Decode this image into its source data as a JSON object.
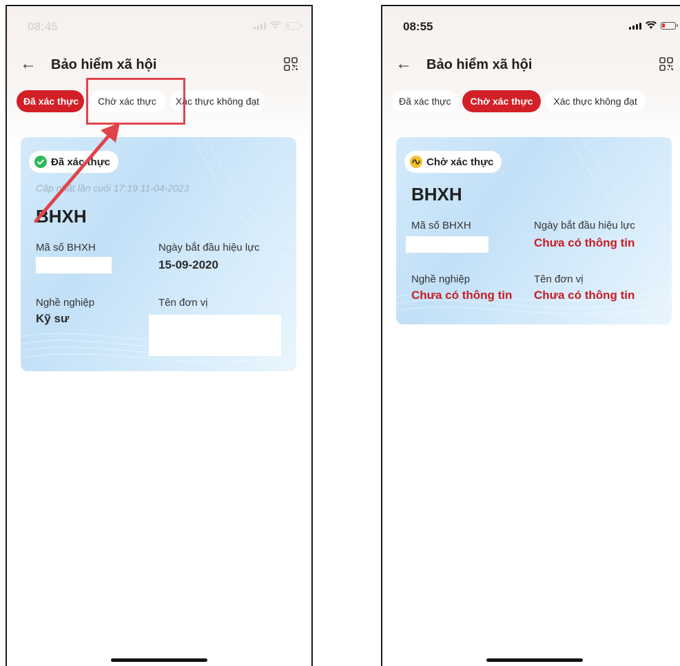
{
  "screens": [
    {
      "status_time": "08:45",
      "title": "Bảo hiểm xã hội",
      "tabs": [
        {
          "label": "Đã xác thực",
          "active": true
        },
        {
          "label": "Chờ xác thực",
          "active": false
        },
        {
          "label": "Xác thực không đạt",
          "active": false
        }
      ],
      "card": {
        "status": "Đã xác thực",
        "status_icon": "check-circle-icon",
        "updated": "Cập nhật lần cuối 17:19 11-04-2023",
        "name": "BHXH",
        "fields": [
          {
            "label": "Mã số BHXH",
            "value": ""
          },
          {
            "label": "Ngày bắt đầu hiệu lực",
            "value": "15-09-2020"
          },
          {
            "label": "Nghề nghiệp",
            "value": "Kỹ sư"
          },
          {
            "label": "Tên đơn vị",
            "value": ""
          }
        ]
      }
    },
    {
      "status_time": "08:55",
      "title": "Bảo hiểm xã hội",
      "tabs": [
        {
          "label": "Đã xác thực",
          "active": false
        },
        {
          "label": "Chờ xác thực",
          "active": true
        },
        {
          "label": "Xác thực không đạt",
          "active": false
        }
      ],
      "card": {
        "status": "Chờ xác thực",
        "status_icon": "pending-wave-icon",
        "name": "BHXH",
        "fields": [
          {
            "label": "Mã số BHXH",
            "value": ""
          },
          {
            "label": "Ngày bắt đầu hiệu lực",
            "value": "Chưa có thông tin"
          },
          {
            "label": "Nghề nghiệp",
            "value": "Chưa có thông tin"
          },
          {
            "label": "Tên đơn vị",
            "value": "Chưa có thông tin"
          }
        ]
      }
    }
  ],
  "colors": {
    "accent": "#d31f26",
    "missing_value": "#c81c24",
    "annotation": "#e0444b",
    "verified_icon": "#30b85a",
    "pending_icon": "#f2c12e"
  }
}
